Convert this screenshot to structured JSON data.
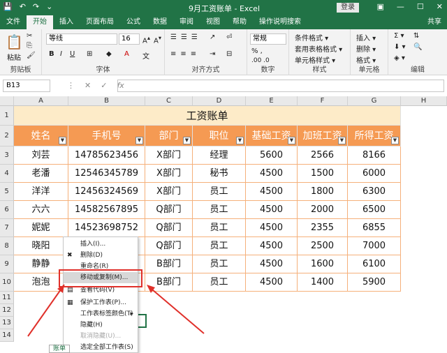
{
  "titlebar": {
    "title": "9月工资账单 - Excel",
    "login": "登录",
    "qat": [
      "💾",
      "↶",
      "↷",
      "⌄"
    ],
    "winbtns": [
      "▣",
      "—",
      "☐",
      "✕"
    ]
  },
  "tabs": [
    "文件",
    "开始",
    "插入",
    "页面布局",
    "公式",
    "数据",
    "审阅",
    "视图",
    "帮助",
    "操作说明搜索"
  ],
  "share": "共享",
  "ribbon": {
    "paste": "粘贴",
    "clipboard_label": "剪贴板",
    "font_name": "等线",
    "font_size": "16",
    "font_label": "字体",
    "align_label": "对齐方式",
    "number_format": "常规",
    "number_label": "数字",
    "styles": [
      "条件格式 ▾",
      "套用表格格式 ▾",
      "单元格样式 ▾"
    ],
    "styles_label": "样式",
    "cells": [
      "插入 ▾",
      "删除 ▾",
      "格式 ▾"
    ],
    "cells_label": "单元格",
    "edit_label": "编辑"
  },
  "formula": {
    "namebox": "B13",
    "icons": [
      "⋮",
      "✕",
      "✓",
      "fx"
    ]
  },
  "columns": [
    "A",
    "B",
    "C",
    "D",
    "E",
    "F",
    "G",
    "H"
  ],
  "rows": [
    "1",
    "2",
    "3",
    "4",
    "5",
    "6",
    "7",
    "8",
    "9",
    "10",
    "11",
    "12",
    "13",
    "14"
  ],
  "sheet_title": "工资账单",
  "headers": [
    "姓名",
    "手机号",
    "部门",
    "职位",
    "基础工资",
    "加班工资",
    "所得工资"
  ],
  "records": [
    [
      "刘芸",
      "14785623456",
      "X部门",
      "经理",
      "5600",
      "2566",
      "8166"
    ],
    [
      "老潘",
      "12546345789",
      "X部门",
      "秘书",
      "4500",
      "1500",
      "6000"
    ],
    [
      "洋洋",
      "12456324569",
      "X部门",
      "员工",
      "4500",
      "1800",
      "6300"
    ],
    [
      "六六",
      "14582567895",
      "Q部门",
      "员工",
      "4500",
      "2000",
      "6500"
    ],
    [
      "妮妮",
      "14523698752",
      "Q部门",
      "员工",
      "4500",
      "2355",
      "6855"
    ],
    [
      "晓阳",
      "",
      "Q部门",
      "员工",
      "4500",
      "2500",
      "7000"
    ],
    [
      "静静",
      "",
      "B部门",
      "员工",
      "4500",
      "1600",
      "6100"
    ],
    [
      "泡泡",
      "",
      "B部门",
      "员工",
      "4500",
      "1400",
      "5900"
    ]
  ],
  "context_menu": [
    {
      "label": "插入(I)...",
      "icon": "",
      "disabled": false
    },
    {
      "label": "删除(D)",
      "icon": "✖",
      "disabled": false
    },
    {
      "label": "重命名(R)",
      "icon": "",
      "disabled": false
    },
    {
      "label": "移动或复制(M)...",
      "icon": "",
      "disabled": false,
      "highlight": true
    },
    {
      "label": "查看代码(V)",
      "icon": "▤",
      "disabled": false
    },
    {
      "label": "保护工作表(P)...",
      "icon": "▦",
      "disabled": false
    },
    {
      "label": "工作表标签颜色(T)",
      "icon": "",
      "disabled": false,
      "submenu": true
    },
    {
      "label": "隐藏(H)",
      "icon": "",
      "disabled": false
    },
    {
      "label": "取消隐藏(U)...",
      "icon": "",
      "disabled": true
    },
    {
      "label": "选定全部工作表(S)",
      "icon": "",
      "disabled": false
    }
  ],
  "sheet_tab": "账单",
  "colors": {
    "accent": "#217346",
    "header_fill": "#f59a53",
    "title_fill": "#fdebc8",
    "annotation": "#e0302a"
  }
}
